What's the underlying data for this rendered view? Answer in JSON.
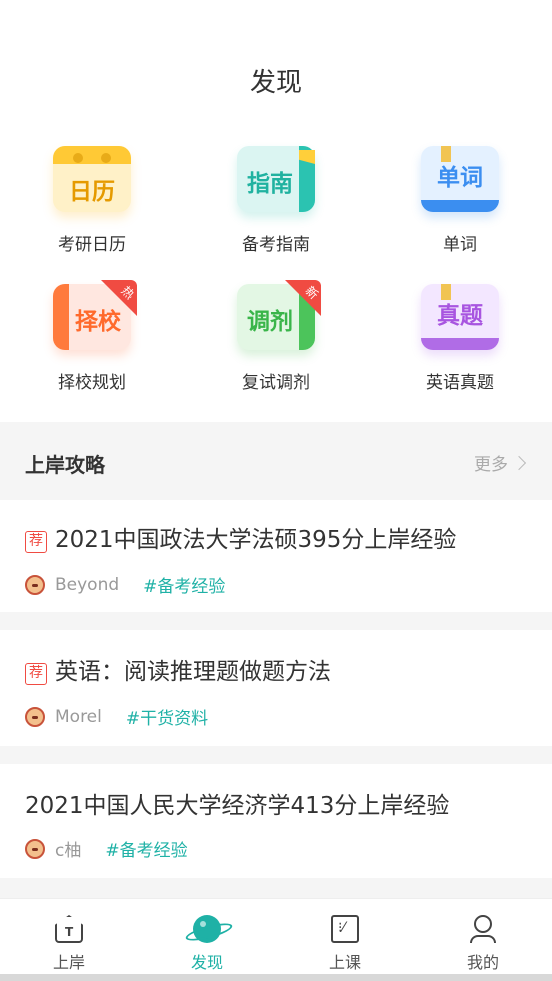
{
  "header": {
    "title": "发现"
  },
  "grid": [
    {
      "tile_text": "日历",
      "label": "考研日历",
      "icon": "calendar-icon"
    },
    {
      "tile_text": "指南",
      "label": "备考指南",
      "icon": "guide-book-icon"
    },
    {
      "tile_text": "单词",
      "label": "单词",
      "icon": "vocabulary-book-icon"
    },
    {
      "tile_text": "择校",
      "label": "择校规划",
      "icon": "school-book-icon",
      "badge": "热"
    },
    {
      "tile_text": "调剂",
      "label": "复试调剂",
      "icon": "adjust-book-icon",
      "badge": "新"
    },
    {
      "tile_text": "真题",
      "label": "英语真题",
      "icon": "exam-book-icon"
    }
  ],
  "section": {
    "title": "上岸攻略",
    "more": "更多"
  },
  "articles": [
    {
      "recommended": "荐",
      "title": "2021中国政法大学法硕395分上岸经验",
      "author": "Beyond",
      "tag": "#备考经验"
    },
    {
      "recommended": "荐",
      "title": "英语：阅读推理题做题方法",
      "author": "Morel",
      "tag": "#干货资料"
    },
    {
      "title": "2021中国人民大学经济学413分上岸经验",
      "author": "c柚",
      "tag": "#备考经验"
    }
  ],
  "tabbar": [
    {
      "label": "上岸",
      "icon": "home-t-icon",
      "icon_glyph": "T"
    },
    {
      "label": "发现",
      "icon": "planet-icon",
      "active": true
    },
    {
      "label": "上课",
      "icon": "class-board-icon",
      "icon_glyph": "⁝⁄"
    },
    {
      "label": "我的",
      "icon": "profile-icon"
    }
  ],
  "colors": {
    "accent": "#1fb1a6",
    "badge_red": "#f04b42"
  }
}
